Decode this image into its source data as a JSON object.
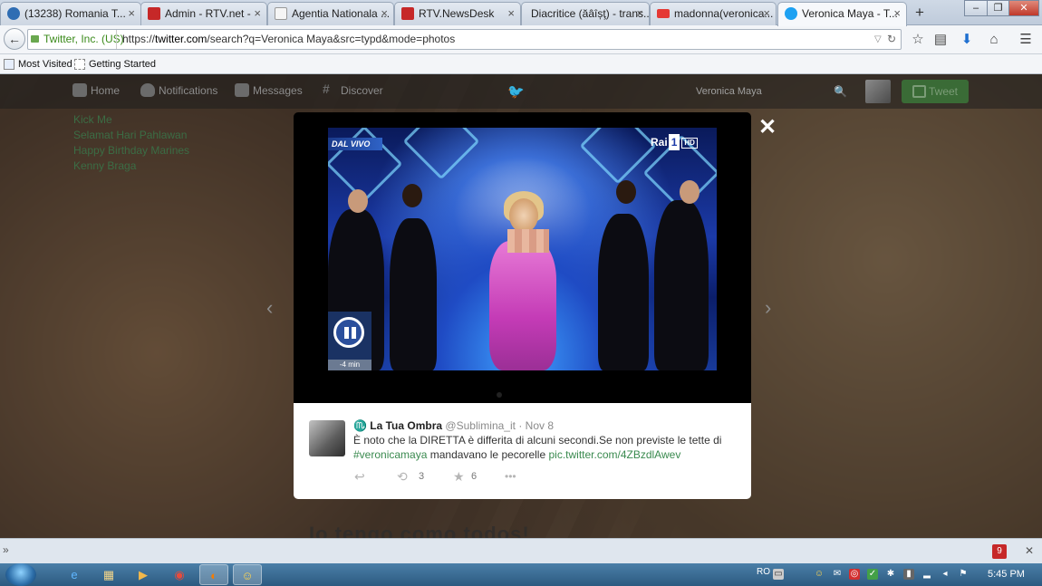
{
  "browser": {
    "tabs": [
      {
        "label": "(13238) Romania T...",
        "color": "#2f6db3"
      },
      {
        "label": "Admin - RTV.net -",
        "color": "#c62828"
      },
      {
        "label": "Agentia Nationala ...",
        "color": "#9e9e9e"
      },
      {
        "label": "RTV.NewsDesk",
        "color": "#c62828"
      },
      {
        "label": "Diacritice (ăâîșţ) - trans...",
        "color": "#cfd8dc"
      },
      {
        "label": "madonna(veronica...",
        "color": "#e53935"
      },
      {
        "label": "Veronica Maya - T...",
        "color": "#1da1f2"
      }
    ],
    "new_tab": "+",
    "identity": "Twitter, Inc. (US)",
    "url_prefix": "https://",
    "url_domain": "twitter.com",
    "url_rest": "/search?q=Veronica Maya&src=typd&mode=photos",
    "bookmarks": [
      "Most Visited",
      "Getting Started"
    ]
  },
  "twitter": {
    "nav": [
      "Home",
      "Notifications",
      "Messages",
      "Discover"
    ],
    "search_value": "Veronica Maya",
    "tweet_button": "Tweet",
    "trends": [
      "Kick Me",
      "Selamat Hari Pahlawan",
      "Happy Birthday Marines",
      "Kenny Braga"
    ],
    "background_caption": "Io tengo como todos!"
  },
  "modal": {
    "close": "✕",
    "video": {
      "live_tag": "DAL VIVO",
      "channel": "Rai",
      "channel_number": "1",
      "hd": "HD",
      "time": "-4 min"
    },
    "tweet": {
      "author_name": "♏ La Tua Ombra",
      "handle": "@Sublimina_it",
      "separator": "·",
      "date": "Nov 8",
      "text": "È noto che la DIRETTA è differita di alcuni secondi.Se non previste le tette di",
      "hashtag": "#veronicamaya",
      "text_after": "mandavano le pecorelle",
      "link": "pic.twitter.com/4ZBzdlAwev",
      "retweets": "3",
      "favorites": "6"
    }
  },
  "statusbar": {
    "badge": "9"
  },
  "taskbar": {
    "language": "RO",
    "clock": "5:45 PM"
  }
}
